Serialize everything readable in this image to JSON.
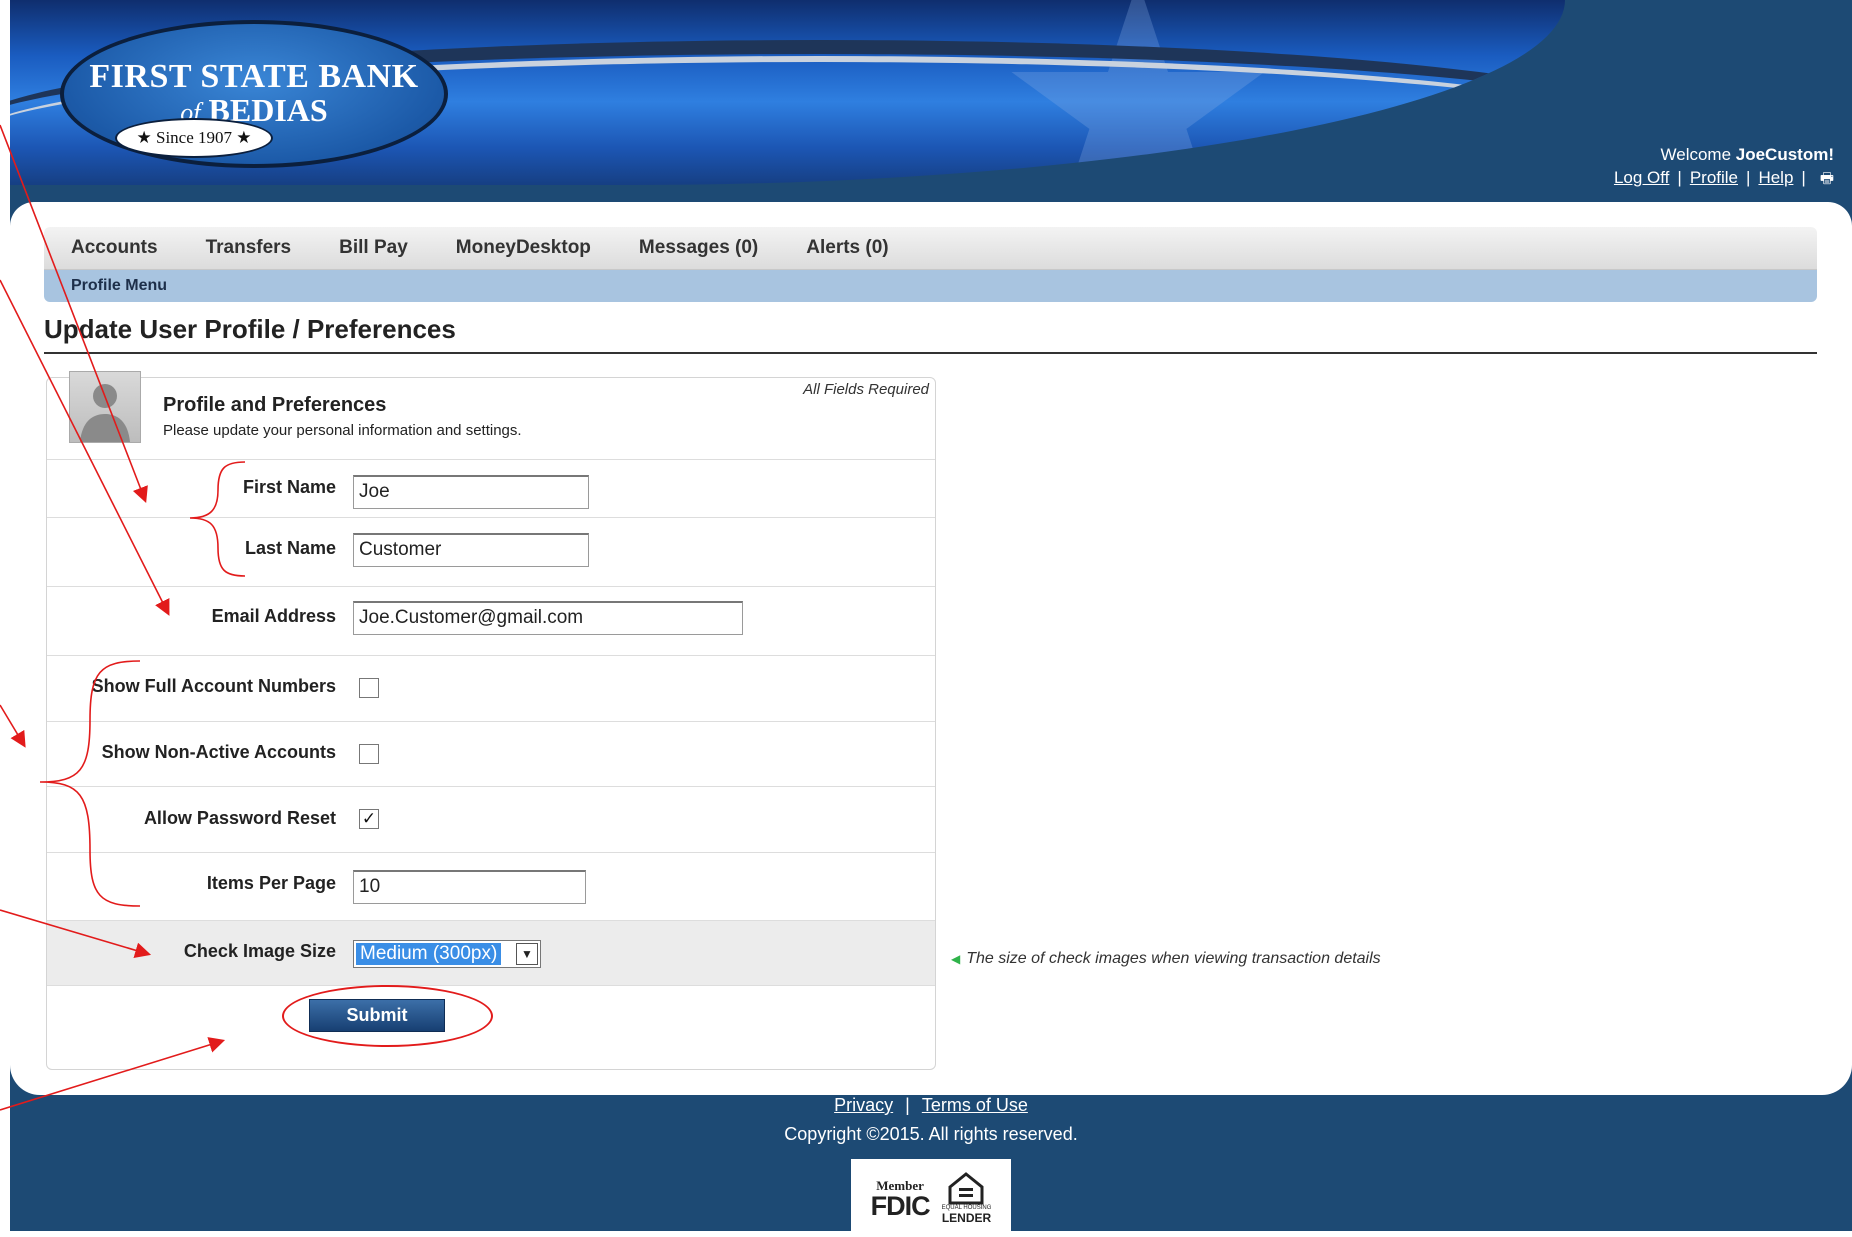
{
  "bank": {
    "name_line1": "FIRST STATE BANK",
    "name_of": "of",
    "name_line2": "BEDIAS",
    "since": "★ Since 1907 ★"
  },
  "user": {
    "welcome_prefix": "Welcome ",
    "name": "JoeCustom!",
    "links": [
      "Log Off",
      "Profile",
      "Help"
    ],
    "print_icon": "printer-icon"
  },
  "nav": {
    "items": [
      "Accounts",
      "Transfers",
      "Bill Pay",
      "MoneyDesktop",
      "Messages (0)",
      "Alerts (0)"
    ],
    "sub": "Profile Menu"
  },
  "page": {
    "title": "Update User Profile / Preferences"
  },
  "form": {
    "header_title": "Profile and Preferences",
    "header_sub": "Please update your personal information and settings.",
    "required_note": "All Fields Required",
    "avatar_icon": "user-silhouette-icon",
    "first_name": {
      "label": "First Name",
      "value": "Joe"
    },
    "last_name": {
      "label": "Last Name",
      "value": "Customer"
    },
    "email": {
      "label": "Email Address",
      "value": "Joe.Customer@gmail.com"
    },
    "show_full_accounts": {
      "label": "Show Full Account Numbers",
      "checked": false
    },
    "show_non_active": {
      "label": "Show Non-Active Accounts",
      "checked": false
    },
    "allow_reset": {
      "label": "Allow Password Reset",
      "checked": true,
      "mark": "✓"
    },
    "items_per_page": {
      "label": "Items Per Page",
      "value": "10"
    },
    "check_image_size": {
      "label": "Check Image Size",
      "value": "Medium (300px)",
      "hint": "The size of check images when viewing transaction details"
    },
    "submit_label": "Submit"
  },
  "footer": {
    "links": [
      "Privacy",
      "Terms of Use"
    ],
    "copyright": "Copyright ©2015. All rights reserved.",
    "fdic_member": "Member",
    "fdic": "FDIC",
    "ehl_small": "EQUAL HOUSING",
    "ehl_lender": "LENDER"
  },
  "colors": {
    "header_blue": "#1d4a74",
    "subnav_blue": "#a8c4e0",
    "button_blue": "#173f72",
    "annotation_red": "#e21b1b",
    "hint_green": "#2fb34a"
  }
}
